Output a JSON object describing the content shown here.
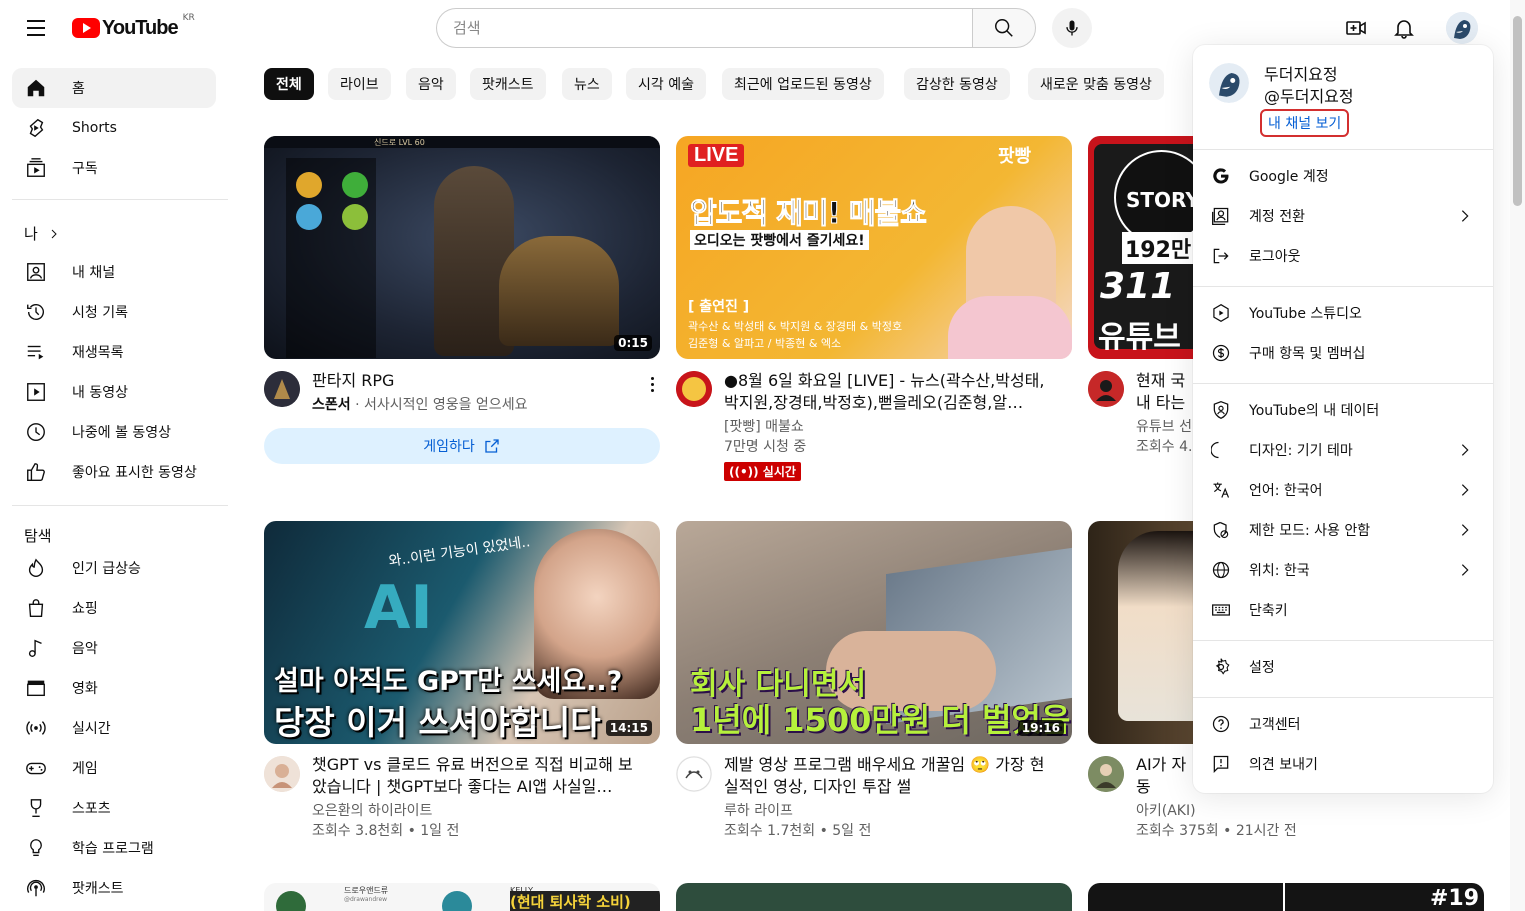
{
  "header": {
    "logo_text": "YouTube",
    "region": "KR",
    "search_placeholder": "검색"
  },
  "sidebar": {
    "main": [
      {
        "label": "홈",
        "icon": "home-icon"
      },
      {
        "label": "Shorts",
        "icon": "shorts-icon"
      },
      {
        "label": "구독",
        "icon": "subscriptions-icon"
      }
    ],
    "you_heading": "나",
    "you": [
      {
        "label": "내 채널",
        "icon": "channel-icon"
      },
      {
        "label": "시청 기록",
        "icon": "history-icon"
      },
      {
        "label": "재생목록",
        "icon": "playlists-icon"
      },
      {
        "label": "내 동영상",
        "icon": "your-videos-icon"
      },
      {
        "label": "나중에 볼 동영상",
        "icon": "watch-later-icon"
      },
      {
        "label": "좋아요 표시한 동영상",
        "icon": "liked-videos-icon"
      }
    ],
    "explore_heading": "탐색",
    "explore": [
      {
        "label": "인기 급상승",
        "icon": "trending-icon"
      },
      {
        "label": "쇼핑",
        "icon": "shopping-icon"
      },
      {
        "label": "음악",
        "icon": "music-icon"
      },
      {
        "label": "영화",
        "icon": "movies-icon"
      },
      {
        "label": "실시간",
        "icon": "live-icon"
      },
      {
        "label": "게임",
        "icon": "gaming-icon"
      },
      {
        "label": "스포츠",
        "icon": "sports-icon"
      },
      {
        "label": "학습 프로그램",
        "icon": "learning-icon"
      },
      {
        "label": "팟캐스트",
        "icon": "podcasts-icon"
      }
    ]
  },
  "chips": [
    "전체",
    "라이브",
    "음악",
    "팟캐스트",
    "뉴스",
    "시각 예술",
    "최근에 업로드된 동영상",
    "감상한 동영상",
    "새로운 맞춤 동영상"
  ],
  "videos": [
    {
      "title": "판타지 RPG",
      "meta1_strong": "스폰서",
      "meta1": " · 서사시적인 영웅을 얻으세요",
      "duration": "0:15",
      "cta": "게임하다",
      "thumb_text": "신드로 LVL 60"
    },
    {
      "title": "●8월 6일 화요일 [LIVE] - 뉴스(곽수산,박성태,박지원,장경태,박정호),뻗을레오(김준형,알…",
      "channel": "[팟빵] 매불쇼",
      "views": "7만명 시청 중",
      "live_label": "실시간",
      "thumb_live": "LIVE",
      "thumb_brand": "팟빵",
      "thumb_headline": "압도적 재미! 매불쇼",
      "thumb_sub": "오디오는 팟빵에서 즐기세요!",
      "thumb_cast_title": "[ 출연진 ]",
      "thumb_cast_1": "곽수산 & 박성태 & 박지원 & 장경태 & 박정호",
      "thumb_cast_2": "김준형 & 알파고 / 박종현 & 엑소"
    },
    {
      "title": "현재 국내 타는법 3",
      "channel": "유튜브 선",
      "views": "조회수 4.",
      "thumb_line1": "STORY",
      "thumb_line2": "192만",
      "thumb_line3": "311",
      "thumb_line4": "유튜브"
    },
    {
      "title": "챗GPT vs 클로드 유료 버전으로 직접 비교해 보았습니다 | 챗GPT보다 좋다는 AI앱 사실일…",
      "channel": "오은환의 하이라이트",
      "views": "조회수 3.8천회 • 1일 전",
      "duration": "14:15",
      "thumb_line1": "설마 아직도 GPT만 쓰세요..?",
      "thumb_line2": "당장 이거 쓰셔야합니다",
      "thumb_small": "와..이런 기능이 있었네.."
    },
    {
      "title": "제발 영상 프로그램 배우세요 개꿀임 🙄 가장 현실적인 영상, 디자인 투잡 썰",
      "channel": "루하 라이프",
      "views": "조회수 1.7천회 • 5일 전",
      "duration": "19:16",
      "thumb_line1": "회사 다니면서",
      "thumb_line2": "1년에 1500만원 더 벌었음"
    },
    {
      "title": "AI가 자동 MAKE 자",
      "channel": "아키(AKI)",
      "views": "조회수 375회 • 21시간 전"
    }
  ],
  "account_menu": {
    "name": "두더지요정",
    "handle": "@두더지요정",
    "view_channel": "내 채널 보기",
    "items": [
      {
        "label": "Google 계정",
        "icon": "google-icon",
        "chevron": false
      },
      {
        "label": "계정 전환",
        "icon": "switch-account-icon",
        "chevron": true
      },
      {
        "label": "로그아웃",
        "icon": "sign-out-icon",
        "chevron": false
      },
      {
        "label": "YouTube 스튜디오",
        "icon": "studio-icon",
        "chevron": false
      },
      {
        "label": "구매 항목 및 멤버십",
        "icon": "purchases-icon",
        "chevron": false
      },
      {
        "label": "YouTube의 내 데이터",
        "icon": "data-shield-icon",
        "chevron": false
      },
      {
        "label": "디자인: 기기 테마",
        "icon": "moon-icon",
        "chevron": true
      },
      {
        "label": "언어: 한국어",
        "icon": "translate-icon",
        "chevron": true
      },
      {
        "label": "제한 모드: 사용 안함",
        "icon": "restricted-icon",
        "chevron": true
      },
      {
        "label": "위치: 한국",
        "icon": "globe-icon",
        "chevron": true
      },
      {
        "label": "단축키",
        "icon": "keyboard-icon",
        "chevron": false
      },
      {
        "label": "설정",
        "icon": "settings-gear-icon",
        "chevron": false
      },
      {
        "label": "고객센터",
        "icon": "help-icon",
        "chevron": false
      },
      {
        "label": "의견 보내기",
        "icon": "feedback-icon",
        "chevron": false
      }
    ]
  },
  "bottom_row": {
    "thumb1_text": "드로우앤드류",
    "thumb1_handle": "@drawandrew",
    "thumb2_text": "KELLY",
    "thumb2_headline": "(현대 퇴사학 소비)",
    "thumb3_text": "#19"
  },
  "colors": {
    "brand_red": "#ff0000",
    "link_blue": "#065fd4",
    "live_red": "#cc0000",
    "highlight_red": "#d32f2f"
  }
}
